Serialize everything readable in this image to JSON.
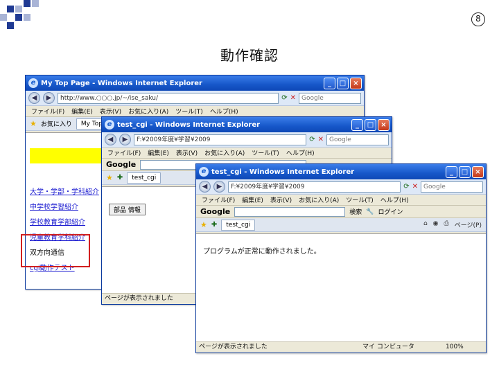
{
  "slide": {
    "number": "8",
    "title": "動作確認",
    "deco_colors": [
      "#1f3a93",
      "#a9b4d6"
    ]
  },
  "window1": {
    "title": "My Top Page - Windows Internet Explorer",
    "address": "http://www.○○○.jp/~/ise_saku/",
    "search_placeholder": "Google",
    "menu": [
      "ファイル(F)",
      "編集(E)",
      "表示(V)",
      "お気に入り(A)",
      "ツール(T)",
      "ヘルプ(H)"
    ],
    "favorites_label": "お気に入り",
    "tab_label": "My Top P...",
    "links": [
      "大学・学部・学科紹介",
      "中学校学習紹介",
      "学校教育学部紹介",
      "児童教育学科紹介",
      "双方向通信",
      "cgi動作テスト"
    ]
  },
  "window2": {
    "title": "test_cgi - Windows Internet Explorer",
    "address": "F:¥2009年度¥学習¥2009",
    "search_placeholder": "Google",
    "menu": [
      "ファイル(F)",
      "編集(E)",
      "表示(V)",
      "お気に入り(A)",
      "ツール(T)",
      "ヘルプ(H)"
    ],
    "google_label": "Google",
    "tab_label": "test_cgi",
    "button_label": "部品 情報",
    "status": "ページが表示されました"
  },
  "window3": {
    "title": "test_cgi - Windows Internet Explorer",
    "address": "F:¥2009年度¥学習¥2009",
    "search_placeholder": "Google",
    "menu": [
      "ファイル(F)",
      "編集(E)",
      "表示(V)",
      "お気に入り(A)",
      "ツール(T)",
      "ヘルプ(H)"
    ],
    "google_label": "Google",
    "google_search": "検索",
    "login_label": "ログイン",
    "tab_label": "test_cgi",
    "page_label": "ページ(P)",
    "message": "プログラムが正常に動作されました。",
    "status_left": "ページが表示されました",
    "status_zone": "マイ コンピュータ",
    "zoom": "100%"
  }
}
